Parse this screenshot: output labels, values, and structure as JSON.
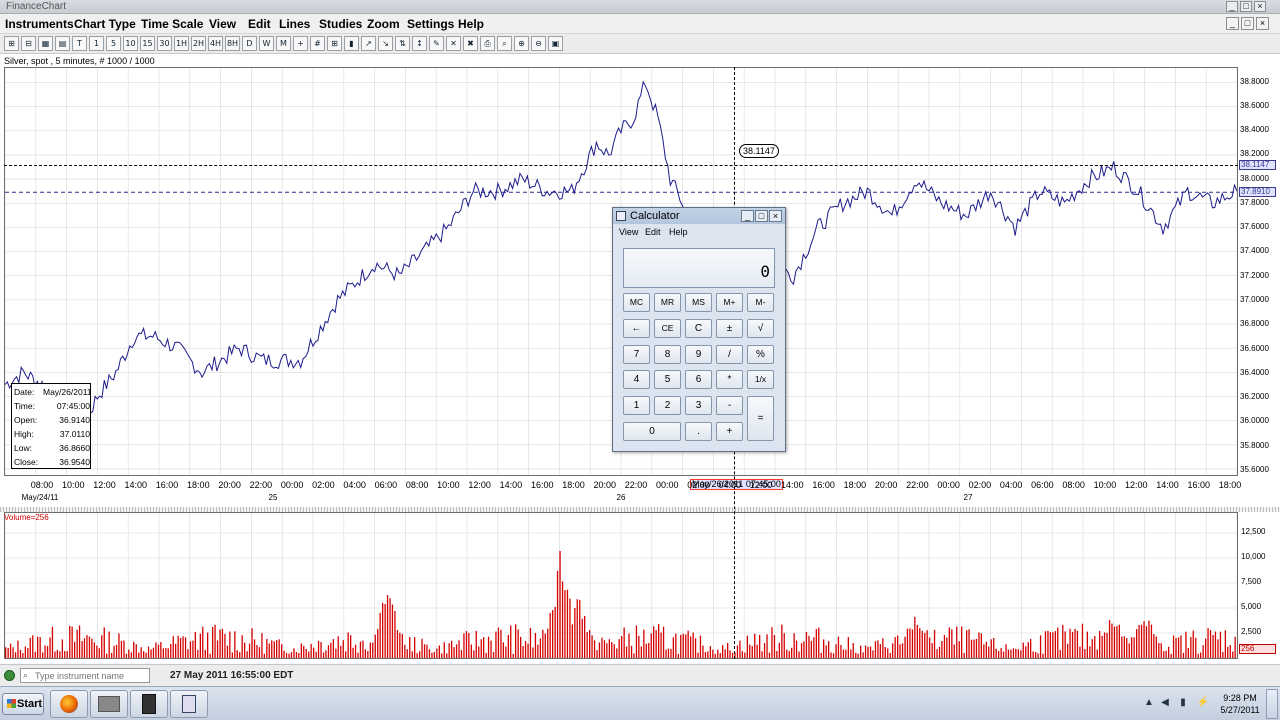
{
  "window": {
    "title": "FinanceChart",
    "controls": [
      "_",
      "□",
      "×"
    ]
  },
  "menu": [
    "Instruments",
    "Chart Type",
    "Time Scale",
    "View",
    "Edit",
    "Lines",
    "Studies",
    "Zoom",
    "Settings",
    "Help"
  ],
  "toolbar": {
    "buttons": [
      "⊞",
      "⊟",
      "▦",
      "▤",
      "T",
      "1",
      "5",
      "10",
      "15",
      "30",
      "1H",
      "2H",
      "4H",
      "8H",
      "D",
      "W",
      "M",
      "+",
      "#",
      "⊞",
      "▮",
      "↗",
      "↘",
      "⇅",
      "↕",
      "✎",
      "✕",
      "✖",
      "⎙",
      "⌕",
      "⊕",
      "⊖",
      "▣"
    ]
  },
  "chart": {
    "instrument_label": "Silver, spot , 5 minutes, # 1000 / 1000",
    "price_ticks": [
      "38.8000",
      "38.6000",
      "38.4000",
      "38.2000",
      "38.0000",
      "37.8000",
      "37.6000",
      "37.4000",
      "37.2000",
      "37.0000",
      "36.8000",
      "36.6000",
      "36.4000",
      "36.2000",
      "36.0000",
      "35.8000",
      "35.6000"
    ],
    "price_tag_current": "38.1147",
    "price_tag_last": "37.8910",
    "cursor_price": "38.1147",
    "time_ticks": [
      "08:00",
      "10:00",
      "12:00",
      "14:00",
      "16:00",
      "18:00",
      "20:00",
      "22:00",
      "00:00",
      "02:00",
      "04:00",
      "06:00",
      "08:00",
      "10:00",
      "12:00",
      "14:00",
      "16:00",
      "18:00",
      "20:00",
      "22:00",
      "00:00",
      "02:00",
      "04:00",
      "12:00",
      "14:00",
      "16:00",
      "18:00",
      "20:00",
      "22:00",
      "00:00",
      "02:00",
      "04:00",
      "06:00",
      "08:00",
      "10:00",
      "12:00",
      "14:00",
      "16:00",
      "18:00"
    ],
    "day_labels": [
      "May/24/11",
      "25",
      "26",
      "27"
    ],
    "cursor_date": "May/26/2011 07:45:00",
    "volume_label": "Volume=256",
    "volume_ticks": [
      "12,500",
      "10,000",
      "7,500",
      "5,000",
      "2,500"
    ],
    "volume_tag": "256"
  },
  "chart_data": {
    "type": "line",
    "title": "",
    "ylim": [
      35.55,
      38.92
    ],
    "volume_ylim": [
      0,
      14500
    ],
    "grid": true,
    "x_range_bars": [
      0,
      1000
    ],
    "price_series": {
      "bar_index": [
        0,
        15,
        30,
        45,
        60,
        75,
        90,
        105,
        120,
        140,
        160,
        190,
        210,
        240,
        270,
        300,
        320,
        340,
        360,
        380,
        400,
        420,
        440,
        460,
        470,
        480,
        490,
        500,
        510,
        520,
        530,
        540,
        550,
        560,
        580,
        600,
        620,
        640,
        660,
        680,
        700,
        720,
        740,
        760,
        780,
        800,
        820,
        840,
        860,
        880,
        900,
        920,
        940,
        960,
        980,
        1000
      ],
      "values": [
        36.3,
        36.4,
        36.3,
        36.0,
        35.9,
        36.2,
        36.4,
        36.7,
        36.7,
        36.6,
        36.4,
        36.6,
        36.5,
        36.5,
        37.0,
        37.3,
        37.2,
        37.4,
        37.6,
        37.9,
        37.9,
        38.0,
        37.9,
        37.9,
        38.1,
        38.3,
        38.2,
        38.4,
        38.5,
        38.8,
        38.5,
        38.0,
        37.8,
        37.4,
        37.2,
        37.4,
        37.3,
        37.2,
        37.6,
        37.8,
        37.9,
        37.7,
        38.0,
        37.8,
        37.7,
        37.9,
        37.6,
        37.9,
        37.8,
        38.0,
        38.1,
        37.9,
        37.6,
        37.9,
        37.8,
        37.9
      ]
    },
    "volume_series": {
      "peaks": [
        {
          "bar": 450,
          "value": 10700
        },
        {
          "bar": 465,
          "value": 6500
        },
        {
          "bar": 310,
          "value": 7200
        },
        {
          "bar": 740,
          "value": 5100
        },
        {
          "bar": 900,
          "value": 5200
        },
        {
          "bar": 925,
          "value": 5000
        }
      ],
      "baseline_range": [
        400,
        3500
      ],
      "last_value": 256
    },
    "data_window": {
      "Date": "May/26/2011",
      "Time": "07:45:00",
      "Open": "36.9140",
      "High": "37.0110",
      "Low": "36.8660",
      "Close": "36.9540"
    }
  },
  "calculator": {
    "title": "Calculator",
    "menu": [
      "View",
      "Edit",
      "Help"
    ],
    "display": "0",
    "rows": [
      [
        "MC",
        "MR",
        "MS",
        "M+",
        "M-"
      ],
      [
        "←",
        "CE",
        "C",
        "±",
        "√"
      ],
      [
        "7",
        "8",
        "9",
        "/",
        "%"
      ],
      [
        "4",
        "5",
        "6",
        "*",
        "1/x"
      ],
      [
        "1",
        "2",
        "3",
        "-",
        "="
      ],
      [
        "0",
        ".",
        "+"
      ]
    ]
  },
  "status": {
    "search_placeholder": "Type instrument name",
    "datetime": "27 May 2011 16:55:00 EDT"
  },
  "taskbar": {
    "start_label": "Start",
    "clock_time": "9:28 PM",
    "clock_date": "5/27/2011"
  },
  "colors": {
    "price_line": "#1c1c8c",
    "volume_bars": "#d40000",
    "grid": "#d8d8d8",
    "ref_line": "#2a2a90"
  }
}
